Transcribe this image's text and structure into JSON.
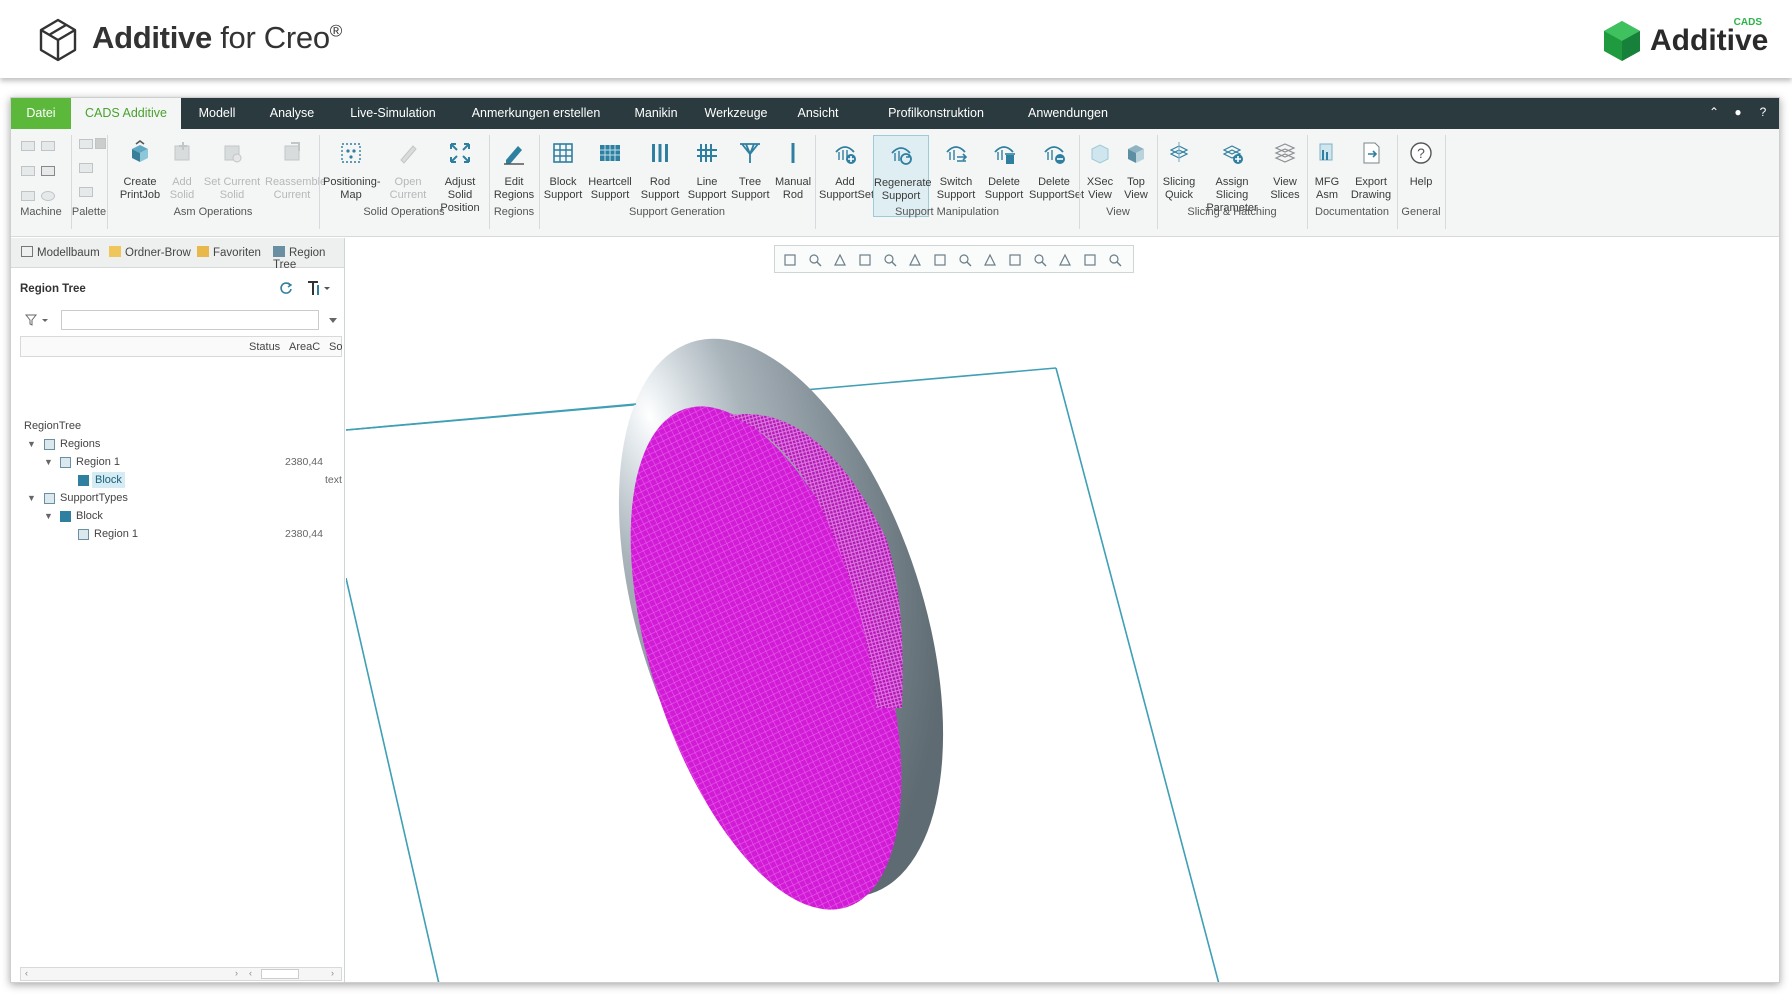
{
  "banner": {
    "title_bold": "Additive",
    "title_rest": " for Creo",
    "title_reg": "®",
    "brand_name": "Additive",
    "brand_sup": "CADS"
  },
  "tabs": [
    "Datei",
    "CADS Additive",
    "Modell",
    "Analyse",
    "Live-Simulation",
    "Anmerkungen erstellen",
    "Manikin",
    "Werkzeuge",
    "Ansicht",
    "Profilkonstruktion",
    "Anwendungen"
  ],
  "ribbon": {
    "buttons": [
      {
        "label": "Create\nPrintJob",
        "icon": "create-printjob-icon"
      },
      {
        "label": "Add\nSolid",
        "icon": "add-solid-icon"
      },
      {
        "label": "Set Current\nSolid",
        "icon": "set-current-solid-icon"
      },
      {
        "label": "Reassemble\nCurrent",
        "icon": "reassemble-current-icon"
      },
      {
        "label": "Positioning-\nMap",
        "icon": "positioning-map-icon"
      },
      {
        "label": "Open\nCurrent",
        "icon": "open-current-icon"
      },
      {
        "label": "Adjust Solid\nPosition",
        "icon": "adjust-solid-position-icon"
      },
      {
        "label": "Edit\nRegions",
        "icon": "edit-regions-icon"
      },
      {
        "label": "Block\nSupport",
        "icon": "block-support-icon"
      },
      {
        "label": "Heartcell\nSupport",
        "icon": "heartcell-support-icon"
      },
      {
        "label": "Rod\nSupport",
        "icon": "rod-support-icon"
      },
      {
        "label": "Line\nSupport",
        "icon": "line-support-icon"
      },
      {
        "label": "Tree\nSupport",
        "icon": "tree-support-icon"
      },
      {
        "label": "Manual\nRod",
        "icon": "manual-rod-icon"
      },
      {
        "label": "Add\nSupportSet",
        "icon": "add-supportset-icon"
      },
      {
        "label": "Regenerate\nSupport",
        "icon": "regenerate-support-icon"
      },
      {
        "label": "Switch\nSupport",
        "icon": "switch-support-icon"
      },
      {
        "label": "Delete\nSupport",
        "icon": "delete-support-icon"
      },
      {
        "label": "Delete\nSupportSet",
        "icon": "delete-supportset-icon"
      },
      {
        "label": "XSec\nView",
        "icon": "xsec-view-icon"
      },
      {
        "label": "Top\nView",
        "icon": "top-view-icon"
      },
      {
        "label": "Slicing\nQuick",
        "icon": "slicing-quick-icon"
      },
      {
        "label": "Assign Slicing\nParameter",
        "icon": "assign-slicing-parameter-icon"
      },
      {
        "label": "View\nSlices",
        "icon": "view-slices-icon"
      },
      {
        "label": "MFG\nAsm",
        "icon": "mfg-asm-icon"
      },
      {
        "label": "Export\nDrawing",
        "icon": "export-drawing-icon"
      },
      {
        "label": "Help",
        "icon": "help-icon"
      }
    ],
    "groups": [
      "Machine",
      "Palette",
      "Asm Operations",
      "Solid Operations",
      "Regions",
      "Support Generation",
      "Support Manipulation",
      "View",
      "Slicing & Hatching",
      "Documentation",
      "General"
    ]
  },
  "panel": {
    "tabs": [
      "Modellbaum",
      "Ordner-Brow",
      "Favoriten",
      "Region Tree"
    ],
    "title": "Region Tree",
    "filter_placeholder": "",
    "columns": [
      "Status",
      "AreaC",
      "So"
    ],
    "tree": [
      {
        "label": "RegionTree",
        "value": ""
      },
      {
        "label": "Regions",
        "value": ""
      },
      {
        "label": "Region 1",
        "value": "2380,44"
      },
      {
        "label": "Block",
        "value": "text"
      },
      {
        "label": "SupportTypes",
        "value": ""
      },
      {
        "label": "Block",
        "value": ""
      },
      {
        "label": "Region 1",
        "value": "2380,44"
      }
    ]
  },
  "colors": {
    "accent_green": "#5cb83a",
    "tabbar": "#2b3a3f",
    "support_magenta": "#d21bd6",
    "part_gray": "#8f9ca4",
    "build_plate": "#3f9fb5"
  }
}
